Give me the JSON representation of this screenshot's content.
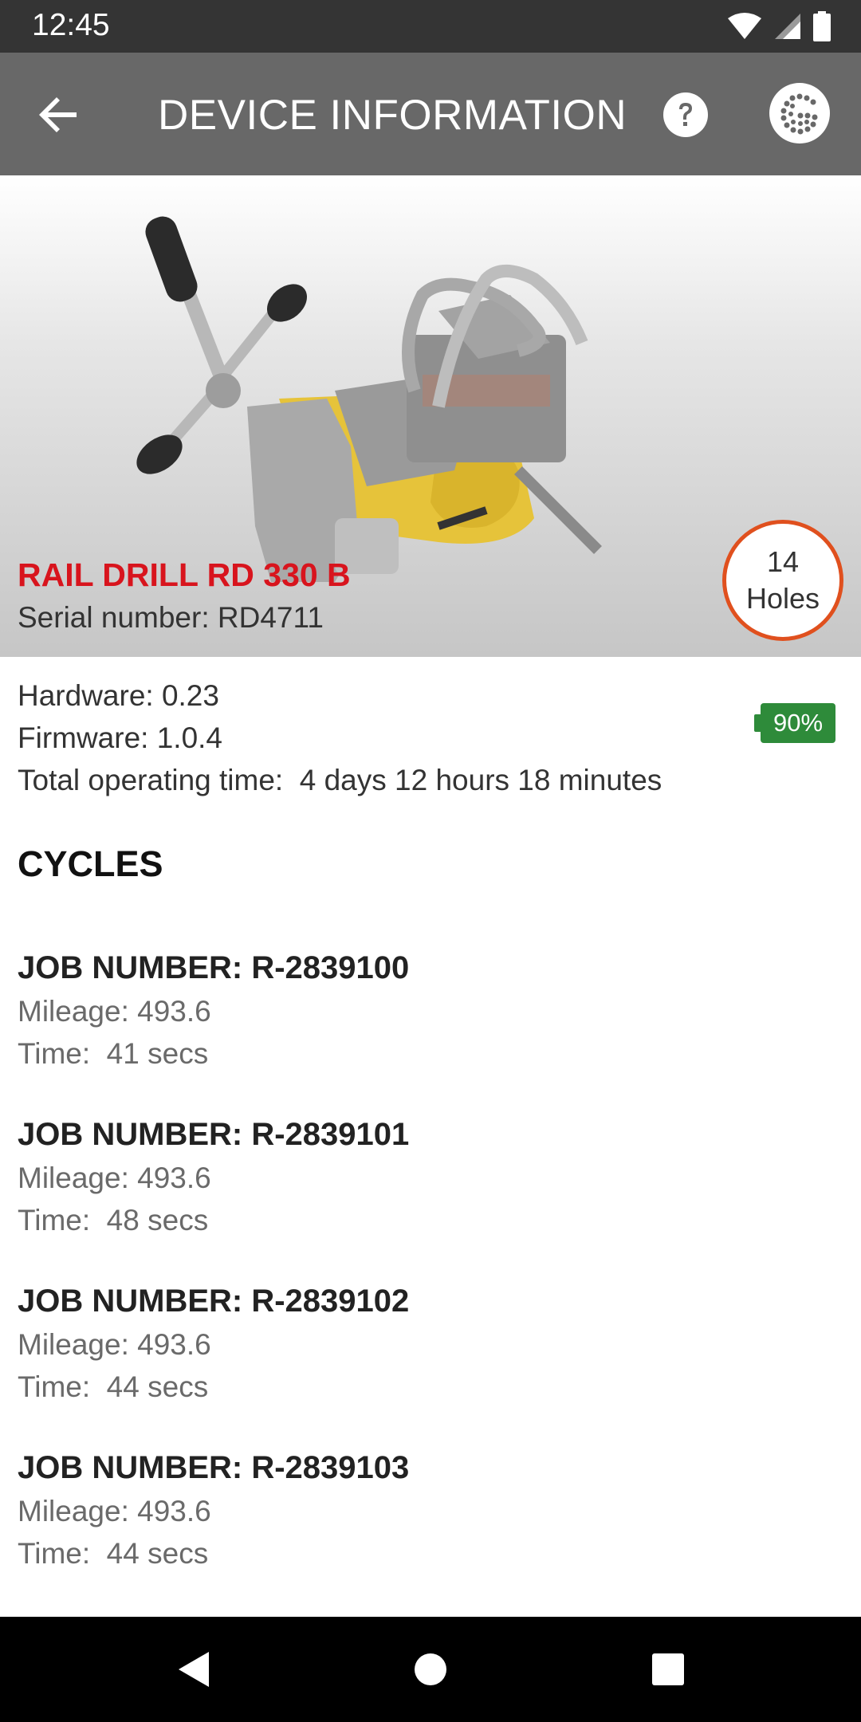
{
  "status_bar": {
    "time": "12:45",
    "icons": [
      "wifi-icon",
      "signal-icon",
      "battery-icon"
    ]
  },
  "app_bar": {
    "title": "DEVICE INFORMATION",
    "back_icon": "arrow-back-icon",
    "help_icon": "help-icon",
    "logo_icon": "brand-logo-icon"
  },
  "device": {
    "name": "RAIL DRILL RD 330 B",
    "serial": "Serial number: RD4711",
    "holes_count": "14",
    "holes_label": "Holes",
    "name_color": "#d8141d",
    "badge_color": "#e0501e"
  },
  "info": {
    "hardware": "Hardware: 0.23",
    "firmware": "Firmware: 1.0.4",
    "operating_time": "Total operating time:  4 days 12 hours 18 minutes",
    "battery": "90%",
    "battery_color": "#2e8b3a"
  },
  "cycles": {
    "title": "CYCLES",
    "items": [
      {
        "job": "JOB NUMBER: R-2839100",
        "mileage": "Mileage: 493.6",
        "time": "Time:  41 secs"
      },
      {
        "job": "JOB NUMBER: R-2839101",
        "mileage": "Mileage: 493.6",
        "time": "Time:  48 secs"
      },
      {
        "job": "JOB NUMBER: R-2839102",
        "mileage": "Mileage: 493.6",
        "time": "Time:  44 secs"
      },
      {
        "job": "JOB NUMBER: R-2839103",
        "mileage": "Mileage: 493.6",
        "time": "Time:  44 secs"
      }
    ]
  },
  "nav_bar": {
    "icons": [
      "nav-back-icon",
      "nav-home-icon",
      "nav-recents-icon"
    ]
  }
}
